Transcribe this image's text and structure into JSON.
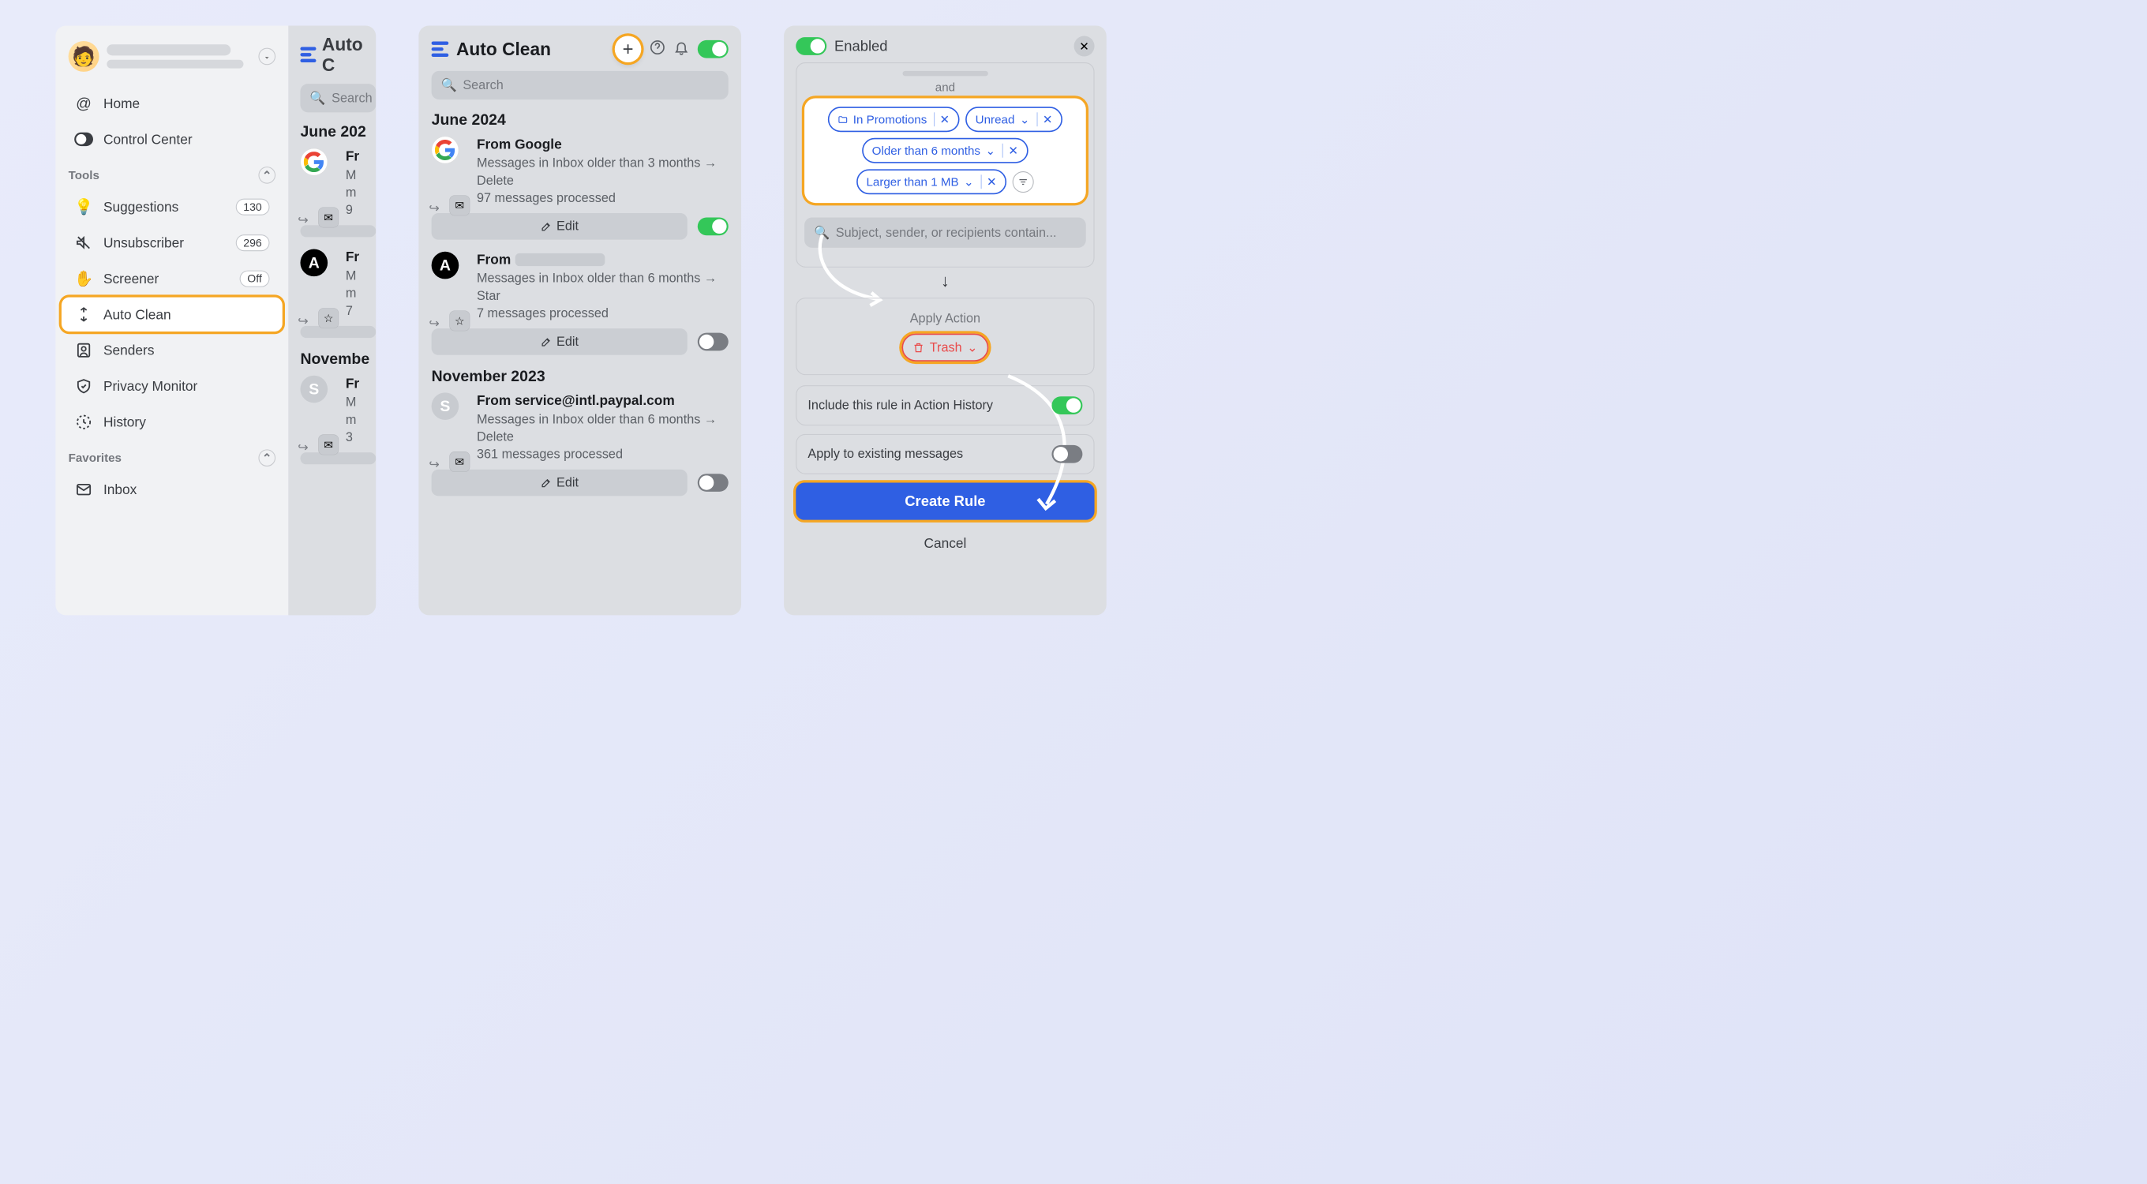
{
  "sidebar": {
    "nav": {
      "home": "Home",
      "control_center": "Control Center"
    },
    "tools_header": "Tools",
    "tools": {
      "suggestions": {
        "label": "Suggestions",
        "badge": "130"
      },
      "unsubscriber": {
        "label": "Unsubscriber",
        "badge": "296"
      },
      "screener": {
        "label": "Screener",
        "badge": "Off"
      },
      "auto_clean": {
        "label": "Auto Clean"
      },
      "senders": {
        "label": "Senders"
      },
      "privacy_monitor": {
        "label": "Privacy Monitor"
      },
      "history": {
        "label": "History"
      }
    },
    "favorites_header": "Favorites",
    "favorites": {
      "inbox": {
        "label": "Inbox"
      }
    }
  },
  "sliver": {
    "title": "Auto C",
    "search": "Search",
    "month1": "June 202",
    "r1_from": "Fr",
    "r1_m": "M",
    "r1_mo": "m",
    "r1_9": "9",
    "r2_from": "Fr",
    "r2_m": "M",
    "r2_mo": "m",
    "r2_7": "7",
    "month2": "Novembe",
    "r3_from": "Fr",
    "r3_m": "M",
    "r3_mo": "m",
    "r3_3": "3"
  },
  "main": {
    "title": "Auto Clean",
    "search_placeholder": "Search",
    "groups": {
      "g1": {
        "header": "June 2024",
        "rules": {
          "r1": {
            "title": "From Google",
            "desc": "Messages in Inbox older than 3 months → Delete",
            "stats": "97 messages processed",
            "edit": "Edit"
          },
          "r2": {
            "title": "From",
            "desc": "Messages in Inbox older than 6 months → Star",
            "stats": "7 messages processed",
            "edit": "Edit"
          }
        }
      },
      "g2": {
        "header": "November 2023",
        "rules": {
          "r1": {
            "title": "From service@intl.paypal.com",
            "desc": "Messages in Inbox older than 6 months → Delete",
            "stats": "361 messages processed",
            "edit": "Edit"
          }
        }
      }
    }
  },
  "editor": {
    "enabled": "Enabled",
    "and": "and",
    "chips": {
      "in_promotions": "In Promotions",
      "unread": "Unread",
      "older": "Older than 6 months",
      "larger": "Larger than 1 MB"
    },
    "search_placeholder": "Subject, sender, or recipients contain...",
    "apply_action": "Apply Action",
    "trash": "Trash",
    "include_history": "Include this rule in Action History",
    "apply_existing": "Apply to existing messages",
    "create": "Create Rule",
    "cancel": "Cancel"
  }
}
